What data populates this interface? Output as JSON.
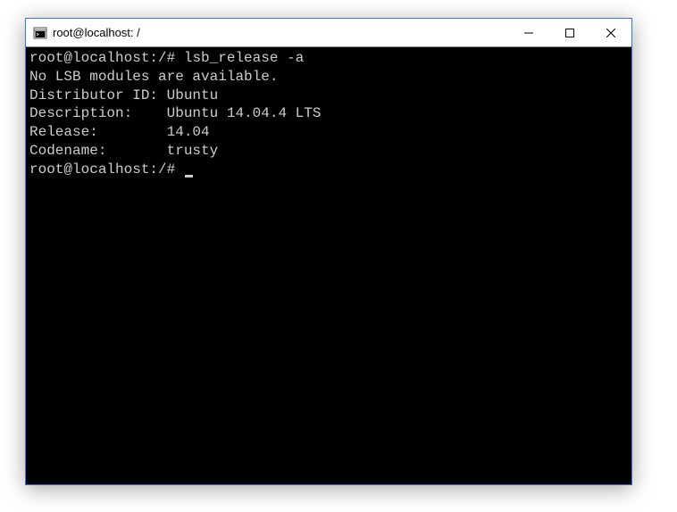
{
  "window": {
    "title": "root@localhost: /"
  },
  "terminal": {
    "prompt": "root@localhost:/#",
    "command": "lsb_release -a",
    "lines": {
      "l0": "No LSB modules are available.",
      "l1": "Distributor ID: Ubuntu",
      "l2": "Description:    Ubuntu 14.04.4 LTS",
      "l3": "Release:        14.04",
      "l4": "Codename:       trusty"
    }
  }
}
